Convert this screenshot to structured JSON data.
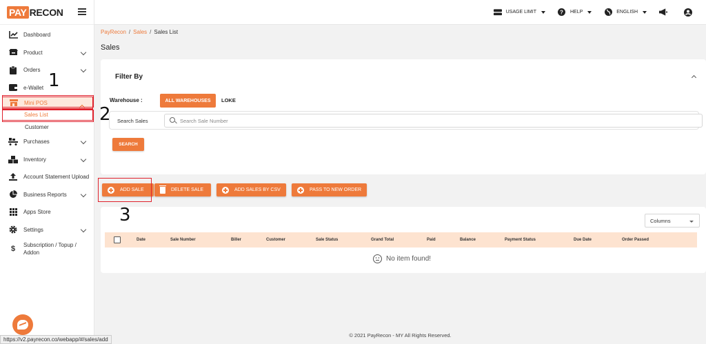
{
  "brand": {
    "logo_pay": "PAY",
    "logo_recon": "RECON"
  },
  "sidebar": {
    "items": [
      {
        "label": "Dashboard",
        "icon": "chart-line-icon"
      },
      {
        "label": "Product",
        "icon": "box-icon"
      },
      {
        "label": "Orders",
        "icon": "clipboard-icon"
      },
      {
        "label": "e-Wallet",
        "icon": "wallet-icon"
      },
      {
        "label": "Mini POS",
        "icon": "store-icon"
      },
      {
        "label": "Purchases",
        "icon": "dolly-icon"
      },
      {
        "label": "Inventory",
        "icon": "boxes-icon"
      },
      {
        "label": "Account Statement Upload",
        "icon": "upload-icon"
      },
      {
        "label": "Business Reports",
        "icon": "pie-chart-icon"
      },
      {
        "label": "Apps Store",
        "icon": "grid-icon"
      },
      {
        "label": "Settings",
        "icon": "gear-icon"
      },
      {
        "label": "Subscription / Topup / Addon",
        "icon": "dollar-icon"
      }
    ],
    "mini_pos_children": [
      "Sales List",
      "Customer"
    ]
  },
  "topbar": {
    "usage_limit": "USAGE LIMIT",
    "help": "HELP",
    "language": "ENGLISH"
  },
  "breadcrumb": {
    "home": "PayRecon",
    "sales": "Sales",
    "current": "Sales List"
  },
  "page_title": "Sales",
  "filter": {
    "title": "Filter By",
    "warehouse_label": "Warehouse :",
    "warehouses": [
      "ALL WAREHOUSES",
      "LOKE"
    ],
    "search_label": "Search Sales",
    "search_placeholder": "Search Sale Number",
    "search_button": "SEARCH"
  },
  "actions": {
    "add_sale": "ADD SALE",
    "delete_sale": "DELETE SALE",
    "add_sales_csv": "ADD SALES BY CSV",
    "pass_to_new_order": "PASS TO NEW ORDER"
  },
  "table": {
    "columns_select": "Columns",
    "headers": [
      "Date",
      "Sale Number",
      "Biller",
      "Customer",
      "Sale Status",
      "Grand Total",
      "Paid",
      "Balance",
      "Payment Status",
      "Due Date",
      "Order Passed"
    ],
    "empty_text": "No item found!"
  },
  "annotations": [
    "1",
    "2",
    "3"
  ],
  "footer": "© 2021 PayRecon - MY All Rights Reserved.",
  "status_url": "https://v2.payrecon.co/webapp/#/sales/add",
  "colors": {
    "accent": "#ee7a3b",
    "highlight": "#e0212c",
    "table_header": "#fde3d0"
  }
}
